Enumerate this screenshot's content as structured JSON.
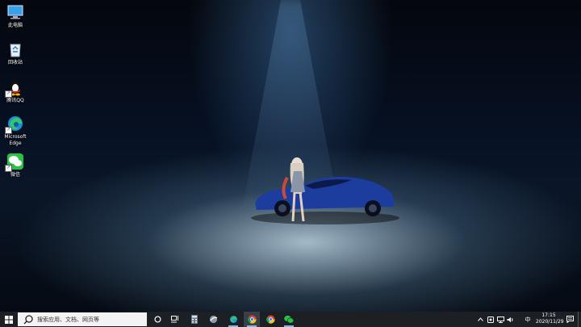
{
  "desktop": {
    "icons": [
      {
        "label": "此电脑",
        "icon": "this-pc-icon"
      },
      {
        "label": "回收站",
        "icon": "recycle-bin-icon"
      },
      {
        "label": "腾讯QQ",
        "icon": "qq-icon"
      },
      {
        "label": "Microsoft Edge",
        "icon": "edge-icon"
      },
      {
        "label": "微信",
        "icon": "wechat-icon"
      }
    ]
  },
  "taskbar": {
    "search_placeholder": "搜索应用、文档、网页等",
    "apps": [
      "cortana-icon",
      "task-view-icon",
      "calculator-icon",
      "browser-icon",
      "edge-icon",
      "chrome-icon",
      "chrome-alt-icon",
      "wechat-icon"
    ],
    "tray": {
      "ime": "中",
      "time": "17:15",
      "date": "2020/11/29"
    }
  },
  "colors": {
    "accent": "#76b9ed",
    "taskbar": "#1c1f24"
  }
}
